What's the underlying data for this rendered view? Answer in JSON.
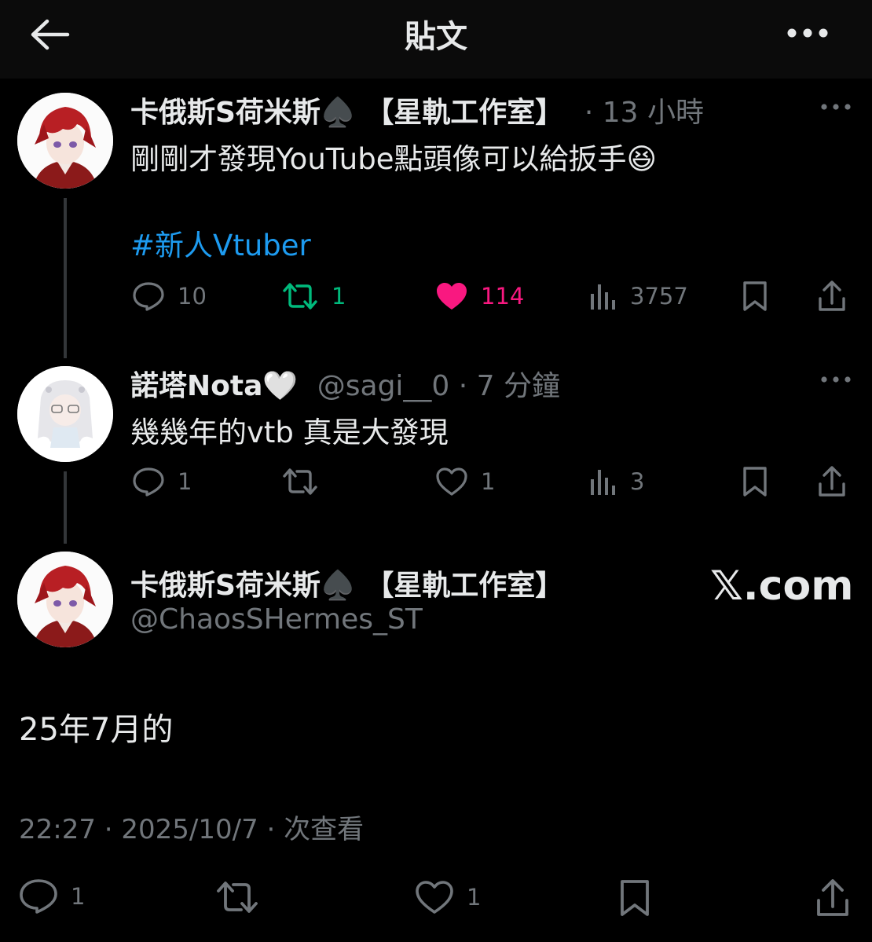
{
  "header": {
    "title": "貼文",
    "back_icon": "arrow-left-icon",
    "more_icon": "more-horizontal-icon"
  },
  "colors": {
    "background": "#000000",
    "text": "#e7e9ea",
    "muted": "#71767b",
    "link": "#1d9bf0",
    "retweet_active": "#00ba7c",
    "like_active": "#f91880"
  },
  "tweet1": {
    "display_name": "卡俄斯S荷米斯♠️ 【星軌工作室】",
    "meta": "· 13 小時",
    "text": "剛剛才發現YouTube點頭像可以給扳手😆",
    "hashtag": "#新人Vtuber",
    "replies": "10",
    "retweets": "1",
    "likes": "114",
    "views": "3757",
    "retweeted": true,
    "liked": true
  },
  "tweet2": {
    "display_name": "諾塔Nota🤍",
    "meta": "@sagi__0 · 7 分鐘",
    "text": "幾幾年的vtb 真是大發現",
    "replies": "1",
    "likes": "1",
    "views": "3"
  },
  "main": {
    "display_name": "卡俄斯S荷米斯♠️ 【星軌工作室】",
    "handle": "@ChaosSHermes_ST",
    "watermark": "𝕏.com",
    "text": "25年7月的",
    "timestamp": "22:27 · 2025/10/7 · 次查看",
    "replies": "1",
    "likes": "1"
  }
}
